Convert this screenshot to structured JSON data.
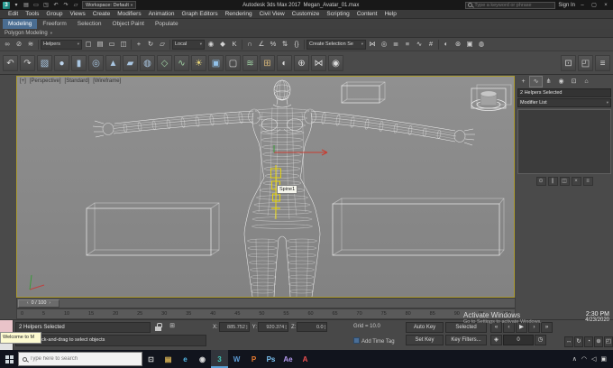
{
  "icons": {
    "chevron_down": "▾",
    "spinner_up": "▴",
    "spinner_down": "▾",
    "abs_offset": "⊞",
    "key_mode": "◈",
    "time_config": "◷"
  },
  "colors": {
    "viewport_bg": "#8a8a8a",
    "selection_yellow": "#ecd800",
    "axis_red": "#c83c30",
    "active_tab_blue": "#4a6d91",
    "taskbar_bg": "#11141d"
  },
  "titlebar": {
    "logo_glyph": "3",
    "quick_icons": [
      {
        "name": "application-menu-icon",
        "glyph": "▾"
      },
      {
        "name": "new-scene-icon",
        "glyph": "▤"
      },
      {
        "name": "open-file-icon",
        "glyph": "▭"
      },
      {
        "name": "save-file-icon",
        "glyph": "◳"
      },
      {
        "name": "undo-icon",
        "glyph": "↶"
      },
      {
        "name": "redo-icon",
        "glyph": "↷"
      },
      {
        "name": "project-folder-icon",
        "glyph": "▱"
      }
    ],
    "workspace_label": "Workspace: Default",
    "app_title": "Autodesk 3ds Max 2017",
    "file_name": "Megan_Avatar_01.max",
    "search_placeholder": "Type a keyword or phrase",
    "sign_in_label": "Sign In",
    "window_buttons": [
      {
        "name": "minimize-button",
        "glyph": "–"
      },
      {
        "name": "maximize-button",
        "glyph": "▢"
      },
      {
        "name": "close-button",
        "glyph": "×"
      }
    ]
  },
  "menubar": {
    "items": [
      "Edit",
      "Tools",
      "Group",
      "Views",
      "Create",
      "Modifiers",
      "Animation",
      "Graph Editors",
      "Rendering",
      "Civil View",
      "Customize",
      "Scripting",
      "Content",
      "Help"
    ]
  },
  "ribbon": {
    "tabs": [
      {
        "name": "tab-modeling",
        "label": "Modeling",
        "active": true
      },
      {
        "name": "tab-freeform",
        "label": "Freeform"
      },
      {
        "name": "tab-selection",
        "label": "Selection"
      },
      {
        "name": "tab-object-paint",
        "label": "Object Paint"
      },
      {
        "name": "tab-populate",
        "label": "Populate"
      }
    ],
    "panel_label": "Polygon Modeling"
  },
  "toolbar_main": {
    "group_link": [
      {
        "name": "select-and-link-icon",
        "glyph": "∞"
      },
      {
        "name": "unlink-selection-icon",
        "glyph": "⊘"
      },
      {
        "name": "bind-to-space-warp-icon",
        "glyph": "≋"
      }
    ],
    "selection_filter": "Helpers",
    "group_select": [
      {
        "name": "select-object-icon",
        "glyph": "▢"
      },
      {
        "name": "select-by-name-icon",
        "glyph": "▤"
      },
      {
        "name": "selection-region-icon",
        "glyph": "▭"
      },
      {
        "name": "window-crossing-icon",
        "glyph": "◫"
      }
    ],
    "group_transform": [
      {
        "name": "select-and-move-icon",
        "glyph": "+"
      },
      {
        "name": "select-and-rotate-icon",
        "glyph": "↻"
      },
      {
        "name": "select-and-scale-icon",
        "glyph": "▱"
      }
    ],
    "coord_system": "Local",
    "group_pivot": [
      {
        "name": "use-pivot-point-icon",
        "glyph": "◉"
      },
      {
        "name": "select-and-manipulate-icon",
        "glyph": "◆"
      },
      {
        "name": "keyboard-override-icon",
        "glyph": "K"
      }
    ],
    "group_snap": [
      {
        "name": "snaps-toggle-icon",
        "glyph": "∩"
      },
      {
        "name": "angle-snap-icon",
        "glyph": "∠"
      },
      {
        "name": "percent-snap-icon",
        "glyph": "%"
      },
      {
        "name": "spinner-snap-icon",
        "glyph": "⇅"
      },
      {
        "name": "edit-named-selection-sets-icon",
        "glyph": "{}"
      }
    ],
    "selection_set_placeholder": "Create Selection Se",
    "group_tools": [
      {
        "name": "mirror-icon",
        "glyph": "⋈"
      },
      {
        "name": "align-icon",
        "glyph": "◎"
      },
      {
        "name": "layer-manager-icon",
        "glyph": "≣"
      },
      {
        "name": "scene-explorer-icon",
        "glyph": "≡"
      },
      {
        "name": "curve-editor-icon",
        "glyph": "∿"
      },
      {
        "name": "schematic-view-icon",
        "glyph": "#"
      }
    ],
    "group_render": [
      {
        "name": "material-editor-icon",
        "glyph": "◐"
      },
      {
        "name": "render-setup-icon",
        "glyph": "⊛"
      },
      {
        "name": "rendered-frame-window-icon",
        "glyph": "▣"
      },
      {
        "name": "render-production-icon",
        "glyph": "◍"
      }
    ]
  },
  "toolbar_secondary": {
    "icons": [
      {
        "name": "undo-view-icon",
        "glyph": "↶",
        "color": "#cfcfcf"
      },
      {
        "name": "redo-view-icon",
        "glyph": "↷",
        "color": "#cfcfcf"
      },
      {
        "name": "box-primitive-icon",
        "glyph": "▧",
        "color": "#a9c6e2"
      },
      {
        "name": "sphere-primitive-icon",
        "glyph": "●",
        "color": "#bcd4ec"
      },
      {
        "name": "cylinder-primitive-icon",
        "glyph": "▮",
        "color": "#a9c6e2"
      },
      {
        "name": "torus-primitive-icon",
        "glyph": "◎",
        "color": "#a9c6e2"
      },
      {
        "name": "cone-primitive-icon",
        "glyph": "▲",
        "color": "#a9c6e2"
      },
      {
        "name": "plane-primitive-icon",
        "glyph": "▰",
        "color": "#a9c6e2"
      },
      {
        "name": "teapot-primitive-icon",
        "glyph": "◍",
        "color": "#a9c6e2"
      },
      {
        "name": "shapes-icon",
        "glyph": "◇",
        "color": "#a0d2a4"
      },
      {
        "name": "splines-icon",
        "glyph": "∿",
        "color": "#a0d2a4"
      },
      {
        "name": "light-icon",
        "glyph": "☀",
        "color": "#ecd978"
      },
      {
        "name": "camera-icon",
        "glyph": "▣",
        "color": "#92c2ea"
      },
      {
        "name": "helper-icon",
        "glyph": "▢",
        "color": "#dadada"
      },
      {
        "name": "space-warp-icon",
        "glyph": "≋",
        "color": "#a0d2a4"
      },
      {
        "name": "systems-icon",
        "glyph": "⊞",
        "color": "#d4b478"
      },
      {
        "name": "material-sample-icon",
        "glyph": "◐",
        "color": "#dadada"
      },
      {
        "name": "attach-icon",
        "glyph": "⊕",
        "color": "#dadada"
      },
      {
        "name": "mirror-tool-icon",
        "glyph": "⋈",
        "color": "#dadada"
      },
      {
        "name": "pivot-tool-icon",
        "glyph": "◉",
        "color": "#dadada"
      }
    ],
    "right_icons": [
      {
        "name": "isolate-selection-icon",
        "glyph": "⊡",
        "color": "#cfcfcf"
      },
      {
        "name": "maximize-layout-icon",
        "glyph": "◰",
        "color": "#cfcfcf"
      },
      {
        "name": "toolbar-overflow-icon",
        "glyph": "≡",
        "color": "#cfcfcf"
      }
    ]
  },
  "viewport": {
    "menu_general": "[+]",
    "menu_pov": "[Perspective]",
    "menu_standard": "[Standard]",
    "menu_shading": "[Wireframe]",
    "tooltip": "Spine1"
  },
  "command_panel": {
    "tabs": [
      {
        "name": "create-tab-icon",
        "glyph": "+"
      },
      {
        "name": "modify-tab-icon",
        "glyph": "∿",
        "active": true
      },
      {
        "name": "hierarchy-tab-icon",
        "glyph": "⋔"
      },
      {
        "name": "motion-tab-icon",
        "glyph": "◉"
      },
      {
        "name": "display-tab-icon",
        "glyph": "⊡"
      },
      {
        "name": "utilities-tab-icon",
        "glyph": "⌂"
      }
    ],
    "selection_label": "2 Helpers Selected",
    "modifier_list_label": "Modifier List",
    "stack_buttons": [
      {
        "name": "pin-stack-button",
        "glyph": "⊙"
      },
      {
        "name": "show-end-result-button",
        "glyph": "∥"
      },
      {
        "name": "make-unique-button",
        "glyph": "◫"
      },
      {
        "name": "remove-modifier-button",
        "glyph": "×"
      },
      {
        "name": "configure-modifier-sets-button",
        "glyph": "≡"
      }
    ]
  },
  "timeline": {
    "slider_label": "0 / 100",
    "ticks": [
      "0",
      "5",
      "10",
      "15",
      "20",
      "25",
      "30",
      "35",
      "40",
      "45",
      "50",
      "55",
      "60",
      "65",
      "70",
      "75",
      "80",
      "85",
      "90",
      "95",
      "100"
    ]
  },
  "status": {
    "selection_text": "2 Helpers Selected",
    "prompt_text": "Click or click-and-drag to select objects",
    "welcome_tooltip": "Welcome to M",
    "x_label": "X:",
    "y_label": "Y:",
    "z_label": "Z:",
    "x_value": "885.752",
    "y_value": "920.374",
    "z_value": "0.0",
    "grid_text": "Grid = 10.0",
    "time_tag_text": "Add Time Tag"
  },
  "animation": {
    "auto_key_label": "Auto Key",
    "set_key_label": "Set Key",
    "selection_set_label": "Selected",
    "key_filters_label": "Key Filters...",
    "frame_value": "0",
    "transport": [
      {
        "name": "go-to-start-button",
        "glyph": "«"
      },
      {
        "name": "previous-frame-button",
        "glyph": "‹"
      },
      {
        "name": "play-animation-button",
        "glyph": "▶"
      },
      {
        "name": "next-frame-button",
        "glyph": "›"
      },
      {
        "name": "go-to-end-button",
        "glyph": "»"
      }
    ],
    "nav_buttons": [
      {
        "name": "pan-view-button",
        "glyph": "↔"
      },
      {
        "name": "orbit-view-button",
        "glyph": "↻"
      },
      {
        "name": "field-of-view-button",
        "glyph": "◔"
      },
      {
        "name": "zoom-button",
        "glyph": "⊕"
      },
      {
        "name": "maximize-viewport-toggle",
        "glyph": "◰"
      }
    ]
  },
  "watermark": {
    "line1": "Activate Windows",
    "line2": "Go to Settings to activate Windows."
  },
  "clock": {
    "time": "2:30 PM",
    "date": "4/23/2020"
  },
  "taskbar": {
    "search_placeholder": "Type here to search",
    "apps": [
      {
        "name": "task-view-button",
        "glyph": "⊡",
        "color": "#d8d8d8"
      },
      {
        "name": "file-explorer-icon",
        "glyph": "▤",
        "color": "#ecc25a"
      },
      {
        "name": "edge-browser-icon",
        "glyph": "e",
        "color": "#52b8e8"
      },
      {
        "name": "chrome-browser-icon",
        "glyph": "◉",
        "color": "#d8d8d8"
      },
      {
        "name": "3dsmax-app-icon",
        "glyph": "3",
        "color": "#3ecab8",
        "active": true
      },
      {
        "name": "word-app-icon",
        "glyph": "W",
        "color": "#5b9bd5"
      },
      {
        "name": "powerpoint-app-icon",
        "glyph": "P",
        "color": "#ed7d31"
      },
      {
        "name": "photoshop-app-icon",
        "glyph": "Ps",
        "color": "#7cc4f5"
      },
      {
        "name": "after-effects-app-icon",
        "glyph": "Ae",
        "color": "#b49af0"
      },
      {
        "name": "acrobat-app-icon",
        "glyph": "A",
        "color": "#f05050"
      }
    ],
    "tray": [
      {
        "name": "hidden-icons-chevron-icon",
        "glyph": "∧"
      },
      {
        "name": "network-icon",
        "glyph": "◠"
      },
      {
        "name": "volume-icon",
        "glyph": "◁"
      },
      {
        "name": "action-center-icon",
        "glyph": "▣"
      }
    ]
  }
}
